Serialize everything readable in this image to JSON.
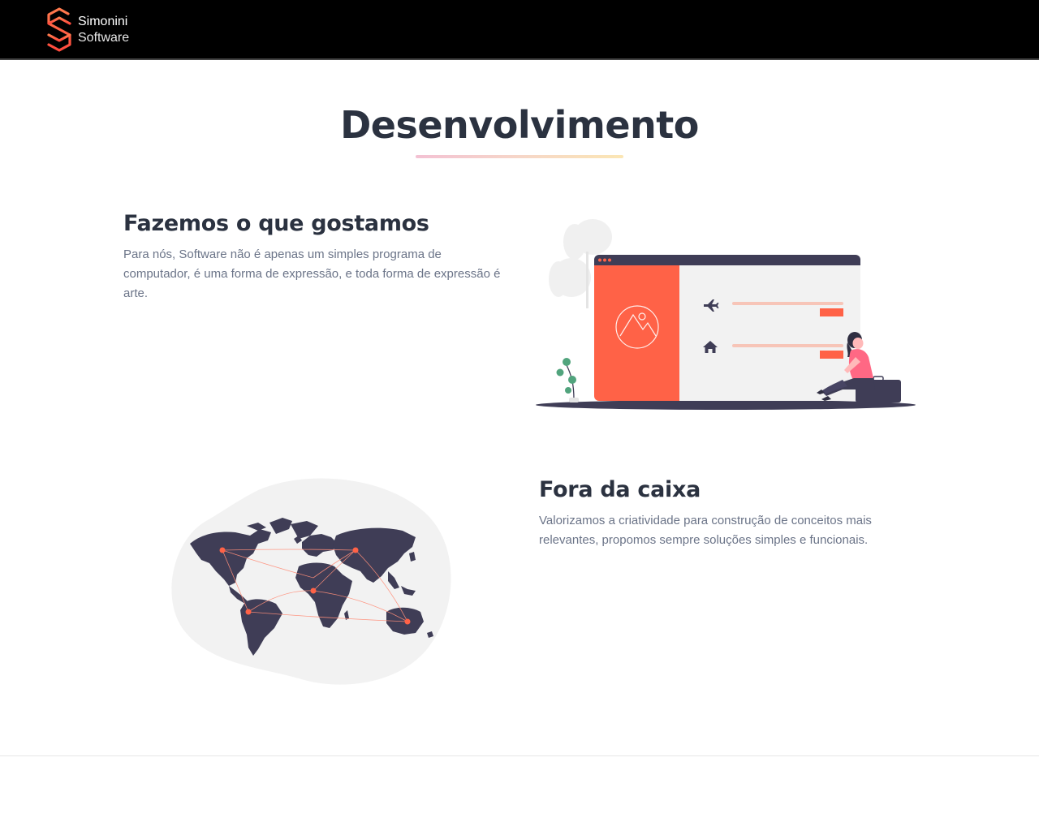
{
  "brand": {
    "name_line1": "Simonini",
    "name_line2": "Software",
    "accent_color": "#ff6247",
    "navbar_color": "#000000"
  },
  "page": {
    "title": "Desenvolvimento"
  },
  "features": [
    {
      "title": "Fazemos o que gostamos",
      "text": "Para nós, Software não é apenas um simples programa de computador, é uma forma de expressão, e toda forma de expressão é arte.",
      "illustration": "travel-booking-illustration"
    },
    {
      "title": "Fora da caixa",
      "text": "Valorizamos a criatividade para construção de conceitos mais relevantes, propomos sempre soluções simples e funcionais.",
      "illustration": "world-map-illustration"
    }
  ],
  "icons": {
    "airplane": "airplane-icon",
    "home": "home-icon",
    "mountain_logo": "mountain-icon"
  },
  "colors": {
    "heading": "#2b3240",
    "body_text": "#6b7488",
    "illustration_dark": "#3f3d56",
    "illustration_light": "#f2f2f2"
  }
}
